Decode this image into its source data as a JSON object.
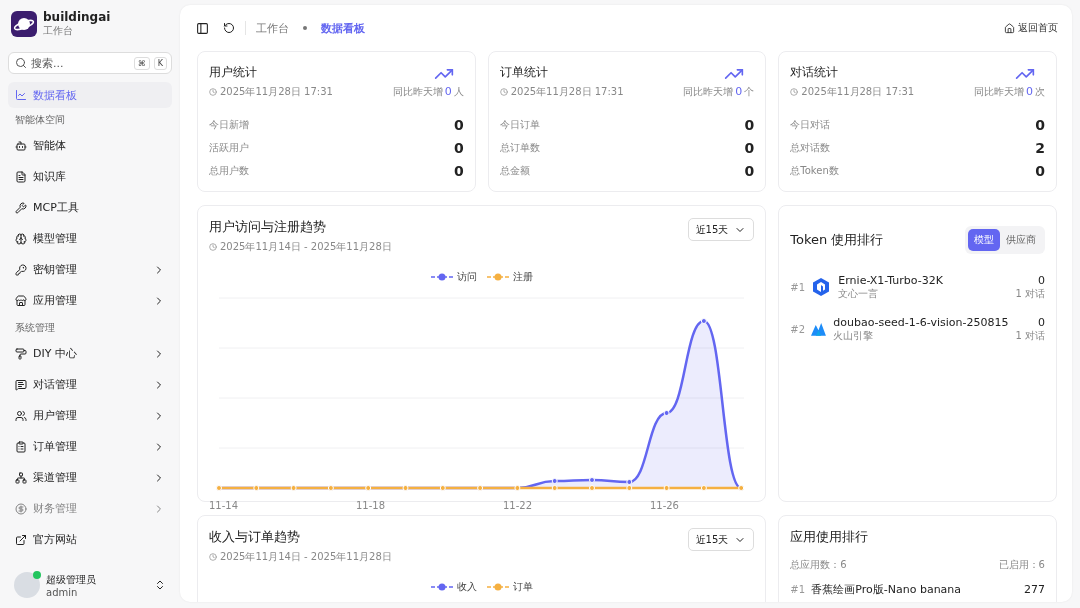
{
  "sidebar": {
    "brand": {
      "name": "buildingai",
      "subtitle": "工作台"
    },
    "search": {
      "placeholder": "搜索...",
      "keys": [
        "⌘",
        "K"
      ]
    },
    "sections": [
      {
        "items": [
          {
            "label": "数据看板",
            "selected": true,
            "expandable": false,
            "disabled": false
          }
        ]
      },
      {
        "title": "智能体空间",
        "items": [
          {
            "label": "智能体",
            "selected": false,
            "expandable": false,
            "disabled": false
          },
          {
            "label": "知识库",
            "selected": false,
            "expandable": false,
            "disabled": false
          },
          {
            "label": "MCP工具",
            "selected": false,
            "expandable": false,
            "disabled": false
          },
          {
            "label": "模型管理",
            "selected": false,
            "expandable": false,
            "disabled": false
          },
          {
            "label": "密钥管理",
            "selected": false,
            "expandable": true,
            "disabled": false
          },
          {
            "label": "应用管理",
            "selected": false,
            "expandable": true,
            "disabled": false
          }
        ]
      },
      {
        "title": "系统管理",
        "items": [
          {
            "label": "DIY 中心",
            "selected": false,
            "expandable": true,
            "disabled": false
          },
          {
            "label": "对话管理",
            "selected": false,
            "expandable": true,
            "disabled": false
          },
          {
            "label": "用户管理",
            "selected": false,
            "expandable": true,
            "disabled": false
          },
          {
            "label": "订单管理",
            "selected": false,
            "expandable": true,
            "disabled": false
          },
          {
            "label": "渠道管理",
            "selected": false,
            "expandable": true,
            "disabled": false
          },
          {
            "label": "财务管理",
            "selected": false,
            "expandable": true,
            "disabled": true
          },
          {
            "label": "官方网站",
            "selected": false,
            "expandable": false,
            "disabled": false
          }
        ]
      }
    ],
    "user": {
      "name": "超级管理员",
      "account": "admin",
      "online": true
    }
  },
  "header": {
    "breadcrumb": [
      "工作台",
      "数据看板"
    ],
    "home_link": "返回首页"
  },
  "stat_cards": [
    {
      "title": "用户统计",
      "time": "2025年11月28日 17:31",
      "trend_label": "同比昨天增",
      "trend_value": "0",
      "trend_unit": "人",
      "rows": [
        {
          "label": "今日新增",
          "value": "0"
        },
        {
          "label": "活跃用户",
          "value": "0"
        },
        {
          "label": "总用户数",
          "value": "0"
        }
      ]
    },
    {
      "title": "订单统计",
      "time": "2025年11月28日 17:31",
      "trend_label": "同比昨天增",
      "trend_value": "0",
      "trend_unit": "个",
      "rows": [
        {
          "label": "今日订单",
          "value": "0"
        },
        {
          "label": "总订单数",
          "value": "0"
        },
        {
          "label": "总金额",
          "value": "0"
        }
      ]
    },
    {
      "title": "对话统计",
      "time": "2025年11月28日 17:31",
      "trend_label": "同比昨天增",
      "trend_value": "0",
      "trend_unit": "次",
      "rows": [
        {
          "label": "今日对话",
          "value": "0"
        },
        {
          "label": "总对话数",
          "value": "2"
        },
        {
          "label": "总Token数",
          "value": "0"
        }
      ]
    }
  ],
  "visit_chart": {
    "title": "用户访问与注册趋势",
    "range": "2025年11月14日 - 2025年11月28日",
    "period": "近15天",
    "legend": [
      {
        "name": "访问",
        "color": "#6366f1"
      },
      {
        "name": "注册",
        "color": "#f5b041"
      }
    ],
    "x_labels": [
      "11-14",
      "11-18",
      "11-22",
      "11-26"
    ]
  },
  "token_rank": {
    "title": "Token 使用排行",
    "tabs": [
      {
        "label": "模型",
        "selected": true
      },
      {
        "label": "供应商",
        "selected": false
      }
    ],
    "items": [
      {
        "rank": "#1",
        "name": "Ernie-X1-Turbo-32K",
        "provider": "文心一言",
        "value": "0",
        "sub": "1 对话"
      },
      {
        "rank": "#2",
        "name": "doubao-seed-1-6-vision-250815",
        "provider": "火山引擎",
        "value": "0",
        "sub": "1 对话"
      }
    ]
  },
  "income_chart": {
    "title": "收入与订单趋势",
    "range": "2025年11月14日 - 2025年11月28日",
    "period": "近15天",
    "legend": [
      {
        "name": "收入",
        "color": "#6366f1"
      },
      {
        "name": "订单",
        "color": "#f5b041"
      }
    ]
  },
  "app_rank": {
    "title": "应用使用排行",
    "total": "总应用数：6",
    "enabled": "已启用：6",
    "items": [
      {
        "rank": "#1",
        "name": "香蕉绘画Pro版-Nano banana",
        "value": "277"
      }
    ]
  }
}
